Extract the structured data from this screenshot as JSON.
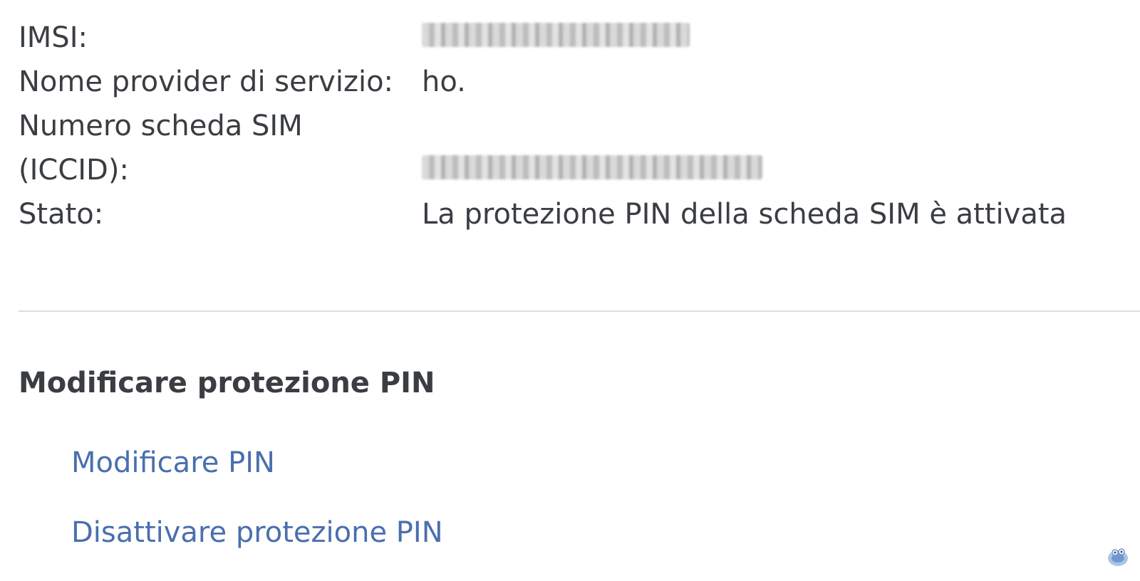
{
  "sim_info": {
    "imsi_label": "IMSI:",
    "provider_label": "Nome provider di servizio:",
    "provider_value": "ho.",
    "iccid_label_line1": "Numero scheda SIM",
    "iccid_label_line2": "(ICCID):",
    "status_label": "Stato:",
    "status_value": "La protezione PIN della scheda SIM è attivata"
  },
  "pin_section": {
    "title": "Modificare protezione PIN",
    "change_pin_link": "Modificare PIN",
    "disable_pin_link": "Disattivare protezione PIN"
  },
  "colors": {
    "text": "#3a3d42",
    "link": "#4a6fae",
    "divider": "#dcdde0"
  },
  "icons": {
    "corner_icon": "mascot-icon"
  }
}
